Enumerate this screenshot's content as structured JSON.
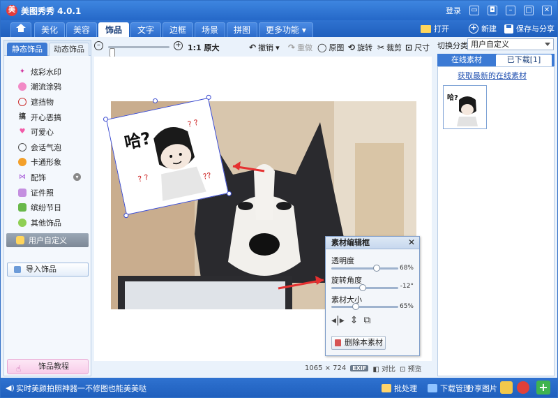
{
  "app": {
    "logo_glyph": "美",
    "title": "美图秀秀 4.0.1"
  },
  "titlebar": {
    "login": "登录"
  },
  "tabs": [
    {
      "label": "美化"
    },
    {
      "label": "美容"
    },
    {
      "label": "饰品",
      "active": true
    },
    {
      "label": "文字"
    },
    {
      "label": "边框"
    },
    {
      "label": "场景"
    },
    {
      "label": "拼图"
    },
    {
      "label": "更多功能"
    }
  ],
  "actions": {
    "open": "打开",
    "new": "新建",
    "save_share": "保存与分享"
  },
  "left": {
    "tabs": [
      "静态饰品",
      "动态饰品"
    ],
    "categories": [
      "炫彩水印",
      "潮流涂鸦",
      "遮挡物",
      "开心恶搞",
      "可爱心",
      "会话气泡",
      "卡通形象",
      "配饰",
      "证件照",
      "缤纷节日",
      "其他饰品"
    ],
    "selected_category": "用户自定义",
    "import_label": "导入饰品",
    "tutorial_label": "饰品教程"
  },
  "toolbar": {
    "zoom_label": "1:1 原大",
    "undo": "撤销",
    "redo": "重做",
    "original": "原图",
    "rotate": "旋转",
    "crop": "裁剪",
    "size": "尺寸"
  },
  "canvas": {
    "sticker_text": "哈?",
    "dimensions": "1065 × 724",
    "exif": "EXIF",
    "compare": "对比",
    "preview": "预览"
  },
  "dialog": {
    "title": "素材编辑框",
    "opacity_label": "透明度",
    "opacity_value": "68%",
    "rotation_label": "旋转角度",
    "rotation_value": "-12°",
    "size_label": "素材大小",
    "size_value": "65%",
    "delete_label": "删除本素材"
  },
  "right": {
    "category_label": "切换分类",
    "category_value": "用户自定义",
    "tabs": [
      "在线素材",
      "已下载[1]"
    ],
    "link": "获取最新的在线素材"
  },
  "statusbar": {
    "text": "实时美颜拍照神器一不修图也能美美哒",
    "batch": "批处理",
    "download_manage": "下载管理",
    "share": "分享图片"
  }
}
